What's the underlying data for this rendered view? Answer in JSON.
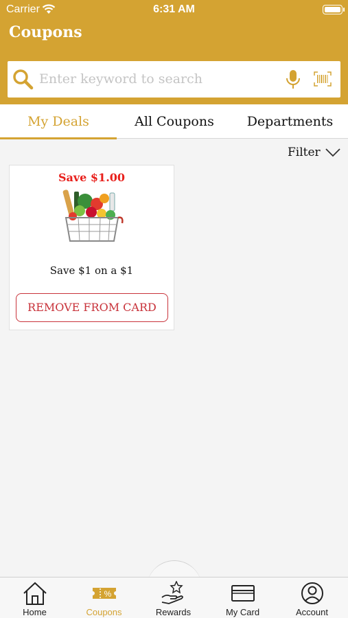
{
  "status_bar": {
    "carrier": "Carrier",
    "time": "6:31 AM"
  },
  "header": {
    "title": "Coupons"
  },
  "search": {
    "placeholder": "Enter keyword to search"
  },
  "tabs": [
    {
      "label": "My Deals",
      "active": true
    },
    {
      "label": "All Coupons",
      "active": false
    },
    {
      "label": "Departments",
      "active": false
    }
  ],
  "filter": {
    "label": "Filter"
  },
  "coupons": [
    {
      "save_text": "Save $1.00",
      "description": "Save $1 on a $1",
      "button_label": "REMOVE FROM CARD",
      "image": "grocery-basket"
    }
  ],
  "bottom_nav": [
    {
      "label": "Home",
      "icon": "home-icon",
      "active": false
    },
    {
      "label": "Coupons",
      "icon": "coupon-icon",
      "active": true
    },
    {
      "label": "Rewards",
      "icon": "rewards-icon",
      "active": false
    },
    {
      "label": "My Card",
      "icon": "card-icon",
      "active": false
    },
    {
      "label": "Account",
      "icon": "account-icon",
      "active": false
    }
  ],
  "colors": {
    "brand": "#d4a332",
    "save_red": "#e8201c",
    "remove_red": "#c8323a"
  }
}
